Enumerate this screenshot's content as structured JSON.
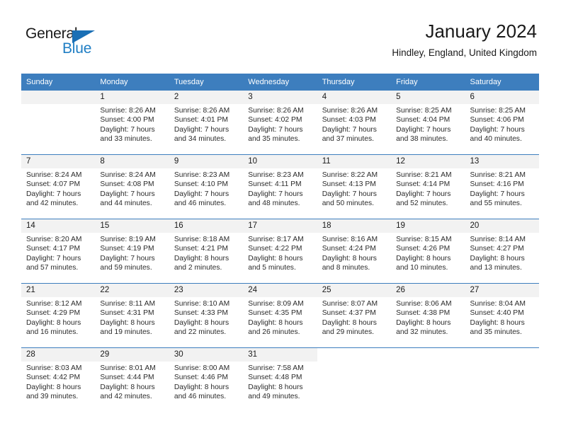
{
  "brand": {
    "name_part1": "General",
    "name_part2": "Blue",
    "triangle_icon": "triangle-icon",
    "accent_color": "#1a6fb5"
  },
  "header": {
    "title": "January 2024",
    "subtitle": "Hindley, England, United Kingdom"
  },
  "theme": {
    "header_blue": "#3d7ebe",
    "day_band_gray": "#f2f2f2",
    "text_color": "#1a1a1a"
  },
  "weekday_headers": [
    "Sunday",
    "Monday",
    "Tuesday",
    "Wednesday",
    "Thursday",
    "Friday",
    "Saturday"
  ],
  "weeks": [
    [
      {
        "day": "",
        "blank": true,
        "sunrise": "",
        "sunset": "",
        "daylight_line1": "",
        "daylight_line2": ""
      },
      {
        "day": "1",
        "sunrise": "Sunrise: 8:26 AM",
        "sunset": "Sunset: 4:00 PM",
        "daylight_line1": "Daylight: 7 hours",
        "daylight_line2": "and 33 minutes."
      },
      {
        "day": "2",
        "sunrise": "Sunrise: 8:26 AM",
        "sunset": "Sunset: 4:01 PM",
        "daylight_line1": "Daylight: 7 hours",
        "daylight_line2": "and 34 minutes."
      },
      {
        "day": "3",
        "sunrise": "Sunrise: 8:26 AM",
        "sunset": "Sunset: 4:02 PM",
        "daylight_line1": "Daylight: 7 hours",
        "daylight_line2": "and 35 minutes."
      },
      {
        "day": "4",
        "sunrise": "Sunrise: 8:26 AM",
        "sunset": "Sunset: 4:03 PM",
        "daylight_line1": "Daylight: 7 hours",
        "daylight_line2": "and 37 minutes."
      },
      {
        "day": "5",
        "sunrise": "Sunrise: 8:25 AM",
        "sunset": "Sunset: 4:04 PM",
        "daylight_line1": "Daylight: 7 hours",
        "daylight_line2": "and 38 minutes."
      },
      {
        "day": "6",
        "sunrise": "Sunrise: 8:25 AM",
        "sunset": "Sunset: 4:06 PM",
        "daylight_line1": "Daylight: 7 hours",
        "daylight_line2": "and 40 minutes."
      }
    ],
    [
      {
        "day": "7",
        "sunrise": "Sunrise: 8:24 AM",
        "sunset": "Sunset: 4:07 PM",
        "daylight_line1": "Daylight: 7 hours",
        "daylight_line2": "and 42 minutes."
      },
      {
        "day": "8",
        "sunrise": "Sunrise: 8:24 AM",
        "sunset": "Sunset: 4:08 PM",
        "daylight_line1": "Daylight: 7 hours",
        "daylight_line2": "and 44 minutes."
      },
      {
        "day": "9",
        "sunrise": "Sunrise: 8:23 AM",
        "sunset": "Sunset: 4:10 PM",
        "daylight_line1": "Daylight: 7 hours",
        "daylight_line2": "and 46 minutes."
      },
      {
        "day": "10",
        "sunrise": "Sunrise: 8:23 AM",
        "sunset": "Sunset: 4:11 PM",
        "daylight_line1": "Daylight: 7 hours",
        "daylight_line2": "and 48 minutes."
      },
      {
        "day": "11",
        "sunrise": "Sunrise: 8:22 AM",
        "sunset": "Sunset: 4:13 PM",
        "daylight_line1": "Daylight: 7 hours",
        "daylight_line2": "and 50 minutes."
      },
      {
        "day": "12",
        "sunrise": "Sunrise: 8:21 AM",
        "sunset": "Sunset: 4:14 PM",
        "daylight_line1": "Daylight: 7 hours",
        "daylight_line2": "and 52 minutes."
      },
      {
        "day": "13",
        "sunrise": "Sunrise: 8:21 AM",
        "sunset": "Sunset: 4:16 PM",
        "daylight_line1": "Daylight: 7 hours",
        "daylight_line2": "and 55 minutes."
      }
    ],
    [
      {
        "day": "14",
        "sunrise": "Sunrise: 8:20 AM",
        "sunset": "Sunset: 4:17 PM",
        "daylight_line1": "Daylight: 7 hours",
        "daylight_line2": "and 57 minutes."
      },
      {
        "day": "15",
        "sunrise": "Sunrise: 8:19 AM",
        "sunset": "Sunset: 4:19 PM",
        "daylight_line1": "Daylight: 7 hours",
        "daylight_line2": "and 59 minutes."
      },
      {
        "day": "16",
        "sunrise": "Sunrise: 8:18 AM",
        "sunset": "Sunset: 4:21 PM",
        "daylight_line1": "Daylight: 8 hours",
        "daylight_line2": "and 2 minutes."
      },
      {
        "day": "17",
        "sunrise": "Sunrise: 8:17 AM",
        "sunset": "Sunset: 4:22 PM",
        "daylight_line1": "Daylight: 8 hours",
        "daylight_line2": "and 5 minutes."
      },
      {
        "day": "18",
        "sunrise": "Sunrise: 8:16 AM",
        "sunset": "Sunset: 4:24 PM",
        "daylight_line1": "Daylight: 8 hours",
        "daylight_line2": "and 8 minutes."
      },
      {
        "day": "19",
        "sunrise": "Sunrise: 8:15 AM",
        "sunset": "Sunset: 4:26 PM",
        "daylight_line1": "Daylight: 8 hours",
        "daylight_line2": "and 10 minutes."
      },
      {
        "day": "20",
        "sunrise": "Sunrise: 8:14 AM",
        "sunset": "Sunset: 4:27 PM",
        "daylight_line1": "Daylight: 8 hours",
        "daylight_line2": "and 13 minutes."
      }
    ],
    [
      {
        "day": "21",
        "sunrise": "Sunrise: 8:12 AM",
        "sunset": "Sunset: 4:29 PM",
        "daylight_line1": "Daylight: 8 hours",
        "daylight_line2": "and 16 minutes."
      },
      {
        "day": "22",
        "sunrise": "Sunrise: 8:11 AM",
        "sunset": "Sunset: 4:31 PM",
        "daylight_line1": "Daylight: 8 hours",
        "daylight_line2": "and 19 minutes."
      },
      {
        "day": "23",
        "sunrise": "Sunrise: 8:10 AM",
        "sunset": "Sunset: 4:33 PM",
        "daylight_line1": "Daylight: 8 hours",
        "daylight_line2": "and 22 minutes."
      },
      {
        "day": "24",
        "sunrise": "Sunrise: 8:09 AM",
        "sunset": "Sunset: 4:35 PM",
        "daylight_line1": "Daylight: 8 hours",
        "daylight_line2": "and 26 minutes."
      },
      {
        "day": "25",
        "sunrise": "Sunrise: 8:07 AM",
        "sunset": "Sunset: 4:37 PM",
        "daylight_line1": "Daylight: 8 hours",
        "daylight_line2": "and 29 minutes."
      },
      {
        "day": "26",
        "sunrise": "Sunrise: 8:06 AM",
        "sunset": "Sunset: 4:38 PM",
        "daylight_line1": "Daylight: 8 hours",
        "daylight_line2": "and 32 minutes."
      },
      {
        "day": "27",
        "sunrise": "Sunrise: 8:04 AM",
        "sunset": "Sunset: 4:40 PM",
        "daylight_line1": "Daylight: 8 hours",
        "daylight_line2": "and 35 minutes."
      }
    ],
    [
      {
        "day": "28",
        "sunrise": "Sunrise: 8:03 AM",
        "sunset": "Sunset: 4:42 PM",
        "daylight_line1": "Daylight: 8 hours",
        "daylight_line2": "and 39 minutes."
      },
      {
        "day": "29",
        "sunrise": "Sunrise: 8:01 AM",
        "sunset": "Sunset: 4:44 PM",
        "daylight_line1": "Daylight: 8 hours",
        "daylight_line2": "and 42 minutes."
      },
      {
        "day": "30",
        "sunrise": "Sunrise: 8:00 AM",
        "sunset": "Sunset: 4:46 PM",
        "daylight_line1": "Daylight: 8 hours",
        "daylight_line2": "and 46 minutes."
      },
      {
        "day": "31",
        "sunrise": "Sunrise: 7:58 AM",
        "sunset": "Sunset: 4:48 PM",
        "daylight_line1": "Daylight: 8 hours",
        "daylight_line2": "and 49 minutes."
      },
      {
        "day": "",
        "empty": true,
        "sunrise": "",
        "sunset": "",
        "daylight_line1": "",
        "daylight_line2": ""
      },
      {
        "day": "",
        "empty": true,
        "sunrise": "",
        "sunset": "",
        "daylight_line1": "",
        "daylight_line2": ""
      },
      {
        "day": "",
        "empty": true,
        "sunrise": "",
        "sunset": "",
        "daylight_line1": "",
        "daylight_line2": ""
      }
    ]
  ]
}
